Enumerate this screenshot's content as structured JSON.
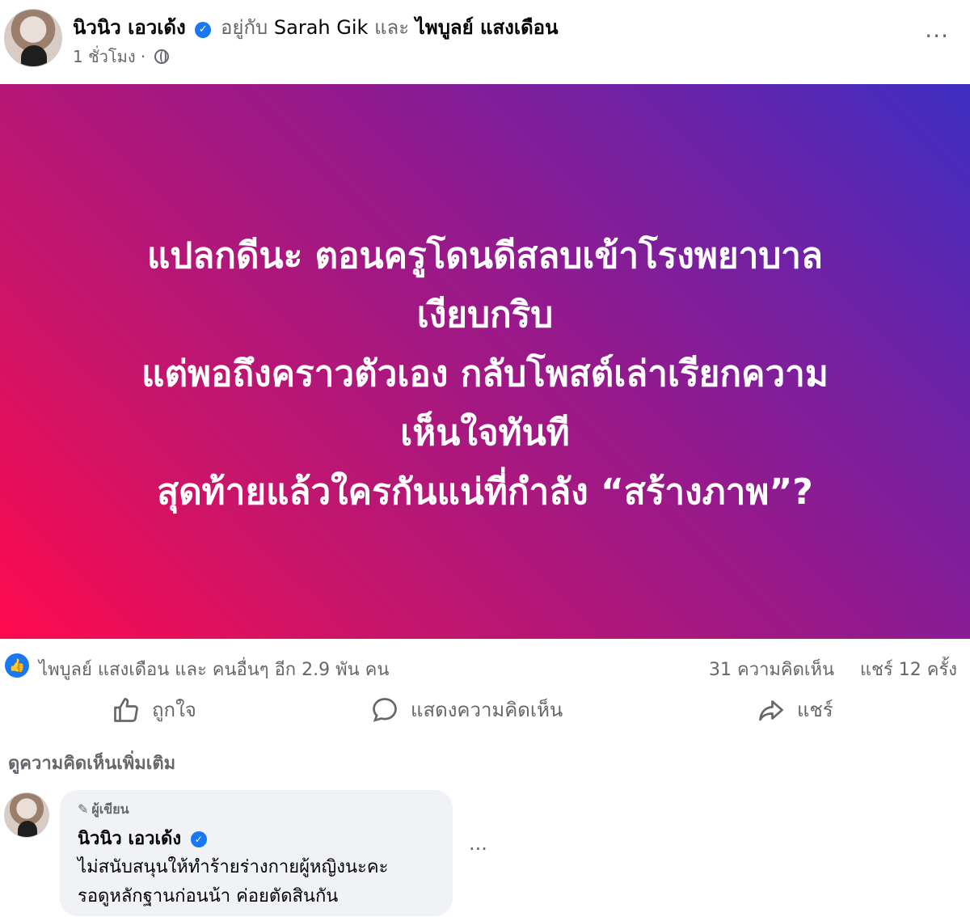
{
  "post": {
    "author": "นิวนิว เอวเด้ง",
    "with_label": "อยู่กับ",
    "tagged_1": "Sarah Gik",
    "and_label": "และ",
    "tagged_2": "ไพบูลย์ แสงเดือน",
    "time": "1 ชั่วโมง ·",
    "more": "···"
  },
  "banner": {
    "lines": [
      "แปลกดีนะ ตอนครูโดนดีสลบเข้าโรงพยาบาล",
      "เงียบกริบ",
      "แต่พอถึงคราวตัวเอง กลับโพสต์เล่าเรียกความ",
      "เห็นใจทันที",
      "สุดท้ายแล้วใครกันแน่ที่กำลัง “สร้างภาพ”?"
    ],
    "gradient_colors": [
      "#ff0a4e",
      "#98198a",
      "#3d2ec2"
    ]
  },
  "stats": {
    "reactors": "ไพบูลย์ แสงเดือน และ คนอื่นๆ อีก 2.9 พัน คน",
    "comments": "31 ความคิดเห็น",
    "shares": "แชร์ 12 ครั้ง"
  },
  "actions": {
    "like": "ถูกใจ",
    "comment": "แสดงความคิดเห็น",
    "share": "แชร์"
  },
  "view_more_comments": "ดูความคิดเห็นเพิ่มเติม",
  "comment": {
    "badge": "ผู้เขียน",
    "author": "นิวนิว เอวเด้ง",
    "line_1": "ไม่สนับสนุนให้ทำร้ายร่างกายผู้หญิงนะคะ",
    "line_2": "รอดูหลักฐานก่อนน้า ค่อยตัดสินกัน",
    "more": "···"
  },
  "colors": {
    "facebook_blue": "#1877f2",
    "secondary_text": "#65676b",
    "comment_bubble": "#f0f2f5"
  }
}
